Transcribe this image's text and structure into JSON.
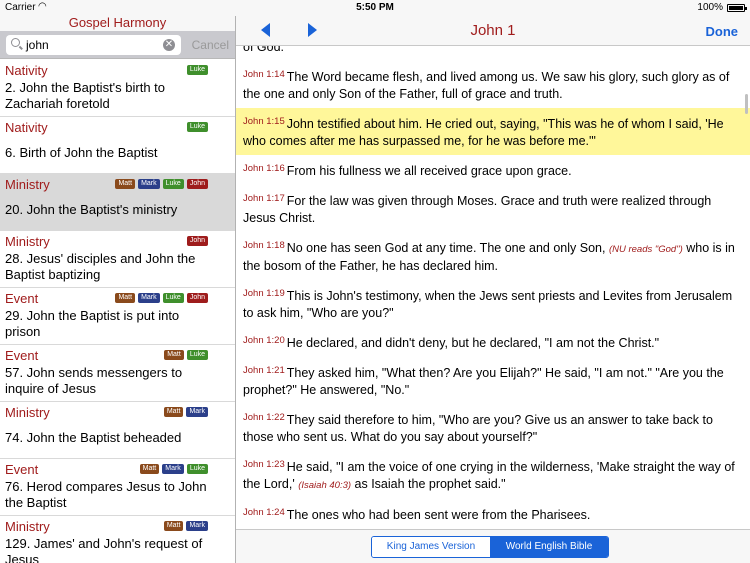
{
  "status": {
    "carrier": "Carrier",
    "time": "5:50 PM",
    "battery": "100%"
  },
  "left": {
    "title": "Gospel Harmony",
    "search": {
      "value": "john",
      "cancel": "Cancel"
    },
    "rows": [
      {
        "category": "Nativity",
        "tags": [
          "Luke"
        ],
        "title": "2. John the Baptist's birth to Zachariah foretold",
        "selected": false
      },
      {
        "category": "Nativity",
        "tags": [
          "Luke"
        ],
        "title": "6. Birth of John the Baptist",
        "selected": false
      },
      {
        "category": "Ministry",
        "tags": [
          "Matt",
          "Mark",
          "Luke",
          "John"
        ],
        "title": "20. John the Baptist's ministry",
        "selected": true
      },
      {
        "category": "Ministry",
        "tags": [
          "John"
        ],
        "title": "28. Jesus' disciples and John the Baptist baptizing",
        "selected": false
      },
      {
        "category": "Event",
        "tags": [
          "Matt",
          "Mark",
          "Luke",
          "John"
        ],
        "title": "29. John the Baptist is put into prison",
        "selected": false
      },
      {
        "category": "Event",
        "tags": [
          "Matt",
          "Luke"
        ],
        "title": "57. John sends messengers to inquire of Jesus",
        "selected": false
      },
      {
        "category": "Ministry",
        "tags": [
          "Matt",
          "Mark"
        ],
        "title": "74. John the Baptist beheaded",
        "selected": false
      },
      {
        "category": "Event",
        "tags": [
          "Matt",
          "Mark",
          "Luke"
        ],
        "title": "76. Herod compares Jesus to John the Baptist",
        "selected": false
      },
      {
        "category": "Ministry",
        "tags": [
          "Matt",
          "Mark"
        ],
        "title": "129. James' and John's request of Jesus",
        "selected": false
      }
    ]
  },
  "nav": {
    "title": "John 1",
    "done": "Done"
  },
  "content": {
    "partial_top": "of God.",
    "verses": [
      {
        "ref": "John 1:14",
        "text": "The Word became flesh, and lived among us. We saw his glory, such glory as of the one and only Son of the Father, full of grace and truth.",
        "highlight": false
      },
      {
        "ref": "John 1:15",
        "text": "John testified about him. He cried out, saying, \"This was he of whom I said, 'He who comes after me has surpassed me, for he was before me.'\"",
        "highlight": true
      },
      {
        "ref": "John 1:16",
        "text": "From his fullness we all received grace upon grace.",
        "highlight": false
      },
      {
        "ref": "John 1:17",
        "text": "For the law was given through Moses. Grace and truth were realized through Jesus Christ.",
        "highlight": false
      },
      {
        "ref": "John 1:18",
        "text_before": "No one has seen God at any time. The one and only Son,",
        "note": "(NU reads \"God\")",
        "text_after": "who is in the bosom of the Father, he has declared him.",
        "highlight": false
      },
      {
        "ref": "John 1:19",
        "text": "This is John's testimony, when the Jews sent priests and Levites from Jerusalem to ask him, \"Who are you?\"",
        "highlight": false
      },
      {
        "ref": "John 1:20",
        "text": "He declared, and didn't deny, but he declared, \"I am not the Christ.\"",
        "highlight": false
      },
      {
        "ref": "John 1:21",
        "text": "They asked him, \"What then? Are you Elijah?\" He said, \"I am not.\" \"Are you the prophet?\" He answered, \"No.\"",
        "highlight": false
      },
      {
        "ref": "John 1:22",
        "text": "They said therefore to him, \"Who are you? Give us an answer to take back to those who sent us. What do you say about yourself?\"",
        "highlight": false
      },
      {
        "ref": "John 1:23",
        "text_before": "He said, \"I am the voice of one crying in the wilderness, 'Make straight the way of the Lord,'",
        "note": "(Isaiah 40:3)",
        "text_after": "as Isaiah the prophet said.\"",
        "highlight": false
      },
      {
        "ref": "John 1:24",
        "text": "The ones who had been sent were from the Pharisees.",
        "highlight": false
      }
    ]
  },
  "versions": {
    "options": [
      "King James Version",
      "World English Bible"
    ],
    "selected": "World English Bible"
  },
  "tag_colors": {
    "Matt": "#8a4a1c",
    "Mark": "#2b3f8a",
    "Luke": "#3f8f2c",
    "John": "#9e1c1c"
  }
}
